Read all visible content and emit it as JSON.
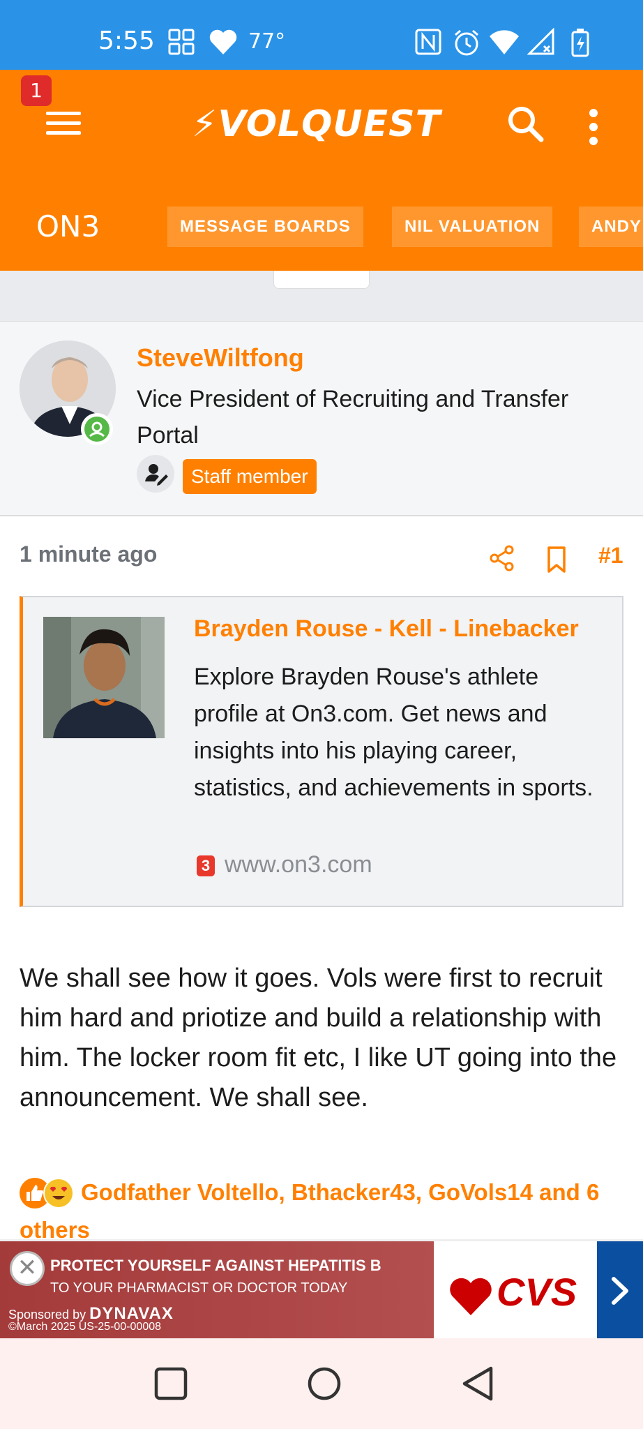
{
  "status_bar": {
    "time": "5:55",
    "temperature": "77°"
  },
  "header": {
    "notification_count": "1",
    "logo_text": "VOLQUEST",
    "brand": "ON3",
    "nav_items": [
      "MESSAGE BOARDS",
      "NIL VALUATION",
      "ANDY"
    ],
    "accent_color": "#ff8000"
  },
  "author": {
    "username": "SteveWiltfong",
    "title": "Vice President of Recruiting and Transfer Portal",
    "badge": "Staff member"
  },
  "post": {
    "time": "1 minute ago",
    "number": "#1",
    "body": "We shall see how it goes. Vols were first to recruit him hard and priotize and build a relationship with him. The locker room fit etc, I like UT going into the announcement. We shall see."
  },
  "embed": {
    "title": "Brayden Rouse - Kell - Linebacker",
    "description": "Explore Brayden Rouse's athlete profile at On3.com. Get news and insights into his playing career, statistics, and achievements in sports.",
    "favicon_text": "3",
    "url": "www.on3.com"
  },
  "reactions": {
    "names": "Godfather Voltello, Bthacker43, GoVols14 and 6",
    "more": "others"
  },
  "ad": {
    "headline": "PROTECT YOURSELF AGAINST HEPATITIS B",
    "subline": "TO YOUR PHARMACIST OR DOCTOR TODAY",
    "sponsored_prefix": "Sponsored by",
    "sponsor": "DYNAVAX",
    "code": "©March 2025 US-25-00-00008",
    "brand": "CVS"
  }
}
